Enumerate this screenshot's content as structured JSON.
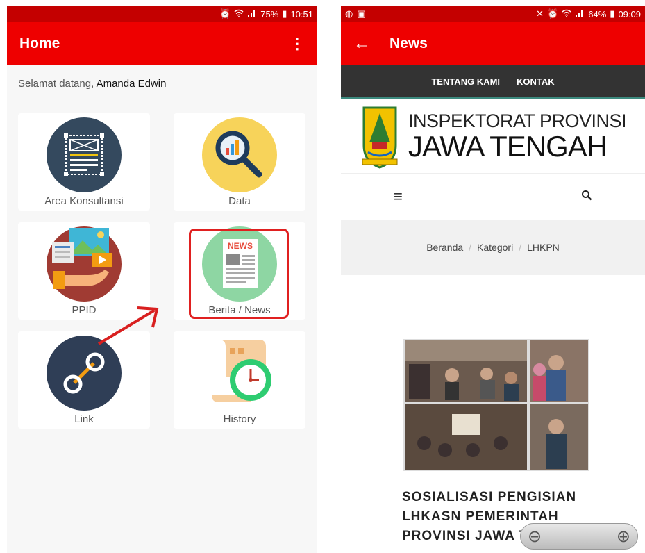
{
  "left_screen": {
    "status": {
      "icons": [
        "alarm-icon",
        "wifi-icon",
        "signal-icon"
      ],
      "battery": "75%",
      "time": "10:51"
    },
    "appbar": {
      "title": "Home",
      "menu_icon": "⋮"
    },
    "welcome": {
      "prefix": "Selamat datang,",
      "name": "Amanda Edwin"
    },
    "tiles": [
      {
        "label": "Area Konsultansi",
        "icon": "layout-icon"
      },
      {
        "label": "Data",
        "icon": "magnifier-chart-icon"
      },
      {
        "label": "PPID",
        "icon": "media-hand-icon"
      },
      {
        "label": "Berita / News",
        "icon": "newspaper-icon",
        "badge": "NEWS"
      },
      {
        "label": "Link",
        "icon": "link-icon"
      },
      {
        "label": "History",
        "icon": "history-clock-icon"
      }
    ]
  },
  "right_screen": {
    "status": {
      "battery": "64%",
      "time": "09:09"
    },
    "appbar": {
      "title": "News",
      "back_icon": "←"
    },
    "nav": {
      "items": [
        "TENTANG KAMI",
        "KONTAK"
      ]
    },
    "logo": {
      "line1": "INSPEKTORAT PROVINSI",
      "line2": "JAWA TENGAH"
    },
    "toolbar": {
      "menu_icon": "≡",
      "search_icon": "⚲"
    },
    "breadcrumb": [
      "Beranda",
      "Kategori",
      "LHKPN"
    ],
    "article": {
      "title": "SOSIALISASI PENGISIAN LHKASN PEMERINTAH PROVINSI JAWA T"
    },
    "zoom": {
      "out": "⊖",
      "in": "⊕"
    }
  },
  "colors": {
    "appbar": "#ee0000",
    "statusbar": "#c40000",
    "nav": "#333333",
    "highlight": "#e02020"
  }
}
